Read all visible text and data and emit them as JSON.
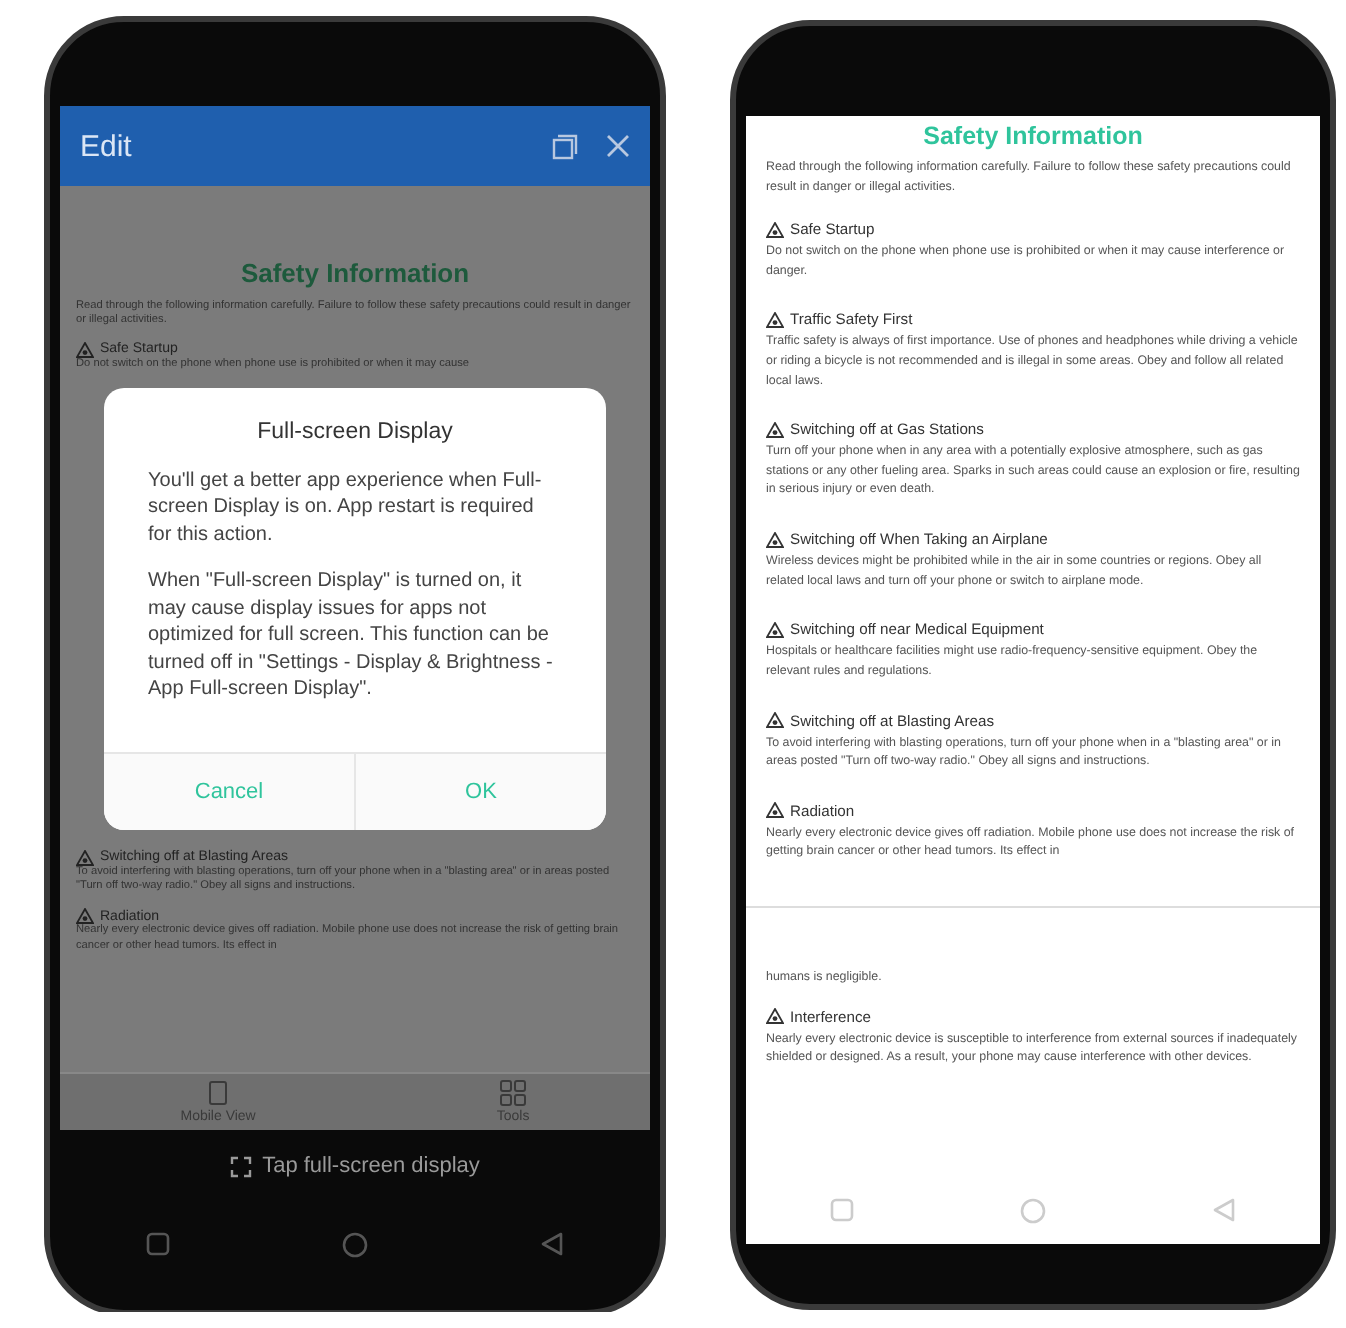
{
  "phones": [
    {
      "kind": "editor",
      "header": {
        "title": "Edit"
      },
      "document": {
        "title": "Safety Information",
        "intro": "Read through the following information carefully. Failure to follow these safety precautions could result in danger or illegal activities.",
        "sections_before": [
          {
            "heading": "Safe Startup",
            "text": "Do not switch on the phone when phone use is prohibited or when it may cause"
          }
        ],
        "sections_after": [
          {
            "heading": "Switching off at Blasting Areas",
            "text": "To avoid interfering with blasting operations, turn off your phone when in a \"blasting area\" or in areas posted \"Turn off two-way radio.\" Obey all signs and instructions."
          },
          {
            "heading": "Radiation",
            "text": "Nearly every electronic device gives off radiation. Mobile phone use does not increase the risk of getting brain cancer or other head tumors. Its effect in"
          }
        ]
      },
      "dialog": {
        "title": "Full-screen Display",
        "paragraphs": [
          "You'll get a better app experience when Full-screen Display is on. App restart is required for this action.",
          "When \"Full-screen Display\" is turned on, it may cause display issues for apps not optimized for full screen. This function can be turned off in \"Settings - Display & Brightness - App Full-screen Display\"."
        ],
        "buttons": [
          {
            "label": "Cancel"
          },
          {
            "label": "OK"
          }
        ]
      },
      "toolbar": [
        {
          "label": "Mobile View",
          "kind": "phone"
        },
        {
          "label": "Tools",
          "kind": "grid"
        }
      ],
      "hint": "Tap full-screen display"
    },
    {
      "kind": "reader",
      "document": {
        "title": "Safety Information",
        "intro": "Read through the following information carefully. Failure to follow these safety precautions could result in danger or illegal activities.",
        "sections": [
          {
            "heading": "Safe Startup",
            "text": "Do not switch on the phone when phone use is prohibited or when it may cause interference or danger."
          },
          {
            "heading": "Traffic Safety First",
            "text": "Traffic safety is always of first importance. Use of phones and headphones while driving a vehicle or riding a bicycle is not recommended and is illegal in some areas. Obey and follow all related local laws."
          },
          {
            "heading": "Switching off at Gas Stations",
            "text": "Turn off your phone when in any area with a potentially explosive atmosphere, such as gas stations or any other fueling area. Sparks in such areas could cause an explosion or fire, resulting in serious injury or even death."
          },
          {
            "heading": "Switching off When Taking an Airplane",
            "text": "Wireless devices might be prohibited while in the air in some countries or regions. Obey all related local laws and turn off your phone or switch to airplane mode."
          },
          {
            "heading": "Switching off near Medical Equipment",
            "text": "Hospitals or healthcare facilities might use radio-frequency-sensitive equipment. Obey the relevant rules and regulations."
          },
          {
            "heading": "Switching off at Blasting Areas",
            "text": "To avoid interfering with blasting operations, turn off your phone when in a \"blasting area\" or in areas posted \"Turn off two-way radio.\" Obey all signs and instructions."
          },
          {
            "heading": "Radiation",
            "text": "Nearly every electronic device gives off radiation. Mobile phone use does not increase the risk of getting brain cancer or other head tumors. Its effect in"
          }
        ],
        "continuation": "humans is negligible.",
        "sections_after": [
          {
            "heading": "Interference",
            "text": "Nearly every electronic device is susceptible to interference from external sources if inadequately shielded or designed. As a result, your phone may cause interference with other devices."
          }
        ]
      }
    }
  ]
}
